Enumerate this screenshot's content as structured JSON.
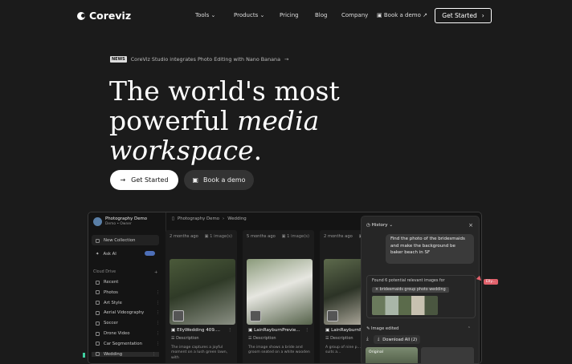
{
  "nav": {
    "brand": "Coreviz",
    "tools": "Tools",
    "products": "Products",
    "pricing": "Pricing",
    "blog": "Blog",
    "company": "Company",
    "book_demo": "Book a demo",
    "get_started": "Get Started"
  },
  "hero": {
    "news_tag": "NEWS",
    "news_text": "CoreViz Studio integrates Photo Editing with Nano Banana",
    "line1": "The world's most",
    "line2a": "powerful ",
    "line2b": "media",
    "line3a": "workspace",
    "line3b": ".",
    "cta_primary": "Get Started",
    "cta_secondary": "Book a demo"
  },
  "app": {
    "workspace": {
      "name": "Photography Demo",
      "role": "Demo • Owner"
    },
    "new_collection": "New Collection",
    "ask_ai": "Ask AI",
    "section": "Cloud Drive",
    "sidebar_items": [
      "Recent",
      "Photos",
      "Art Style",
      "Aerial Videography",
      "Soccer",
      "Drone Video",
      "Car Segmentation",
      "Wedding"
    ],
    "breadcrumb": {
      "root": "Photography Demo",
      "current": "Wedding"
    },
    "columns": [
      {
        "time": "2 months ago",
        "count": "1 image(s)",
        "title": "EllyWedding 409....",
        "desc_label": "Description",
        "desc": "The image captures a joyful moment on a lush green lawn, with",
        "colors": [
          "#4b5a3a",
          "#2f3a27",
          "#8a8f83"
        ]
      },
      {
        "time": "5 months ago",
        "count": "1 image(s)",
        "title": "LainRayburnPrevie...",
        "desc_label": "Description",
        "desc": "The image shows a bride and groom seated on a white wooden",
        "colors": [
          "#8a9a7a",
          "#e6e6e0",
          "#55624a"
        ]
      },
      {
        "time": "2 months ago",
        "count": "1 image(s)",
        "title": "LainRayburnPrevie...",
        "desc_label": "Description",
        "desc": "A group of nine p... navy blue suits a...",
        "colors": [
          "#5d6a4c",
          "#2c3326",
          "#c9c2b5"
        ]
      }
    ],
    "history": {
      "title": "History",
      "message": "Find the photo of the bridesmaids and make the background be baker beach in SF",
      "found": "Found 6 potential relevant images for",
      "query_chip": "bridesmaids group photo wedding",
      "image_edited": "Image edited",
      "download_all": "Download All (2)",
      "original": "Original"
    },
    "cursor_tag": "Elly..."
  }
}
